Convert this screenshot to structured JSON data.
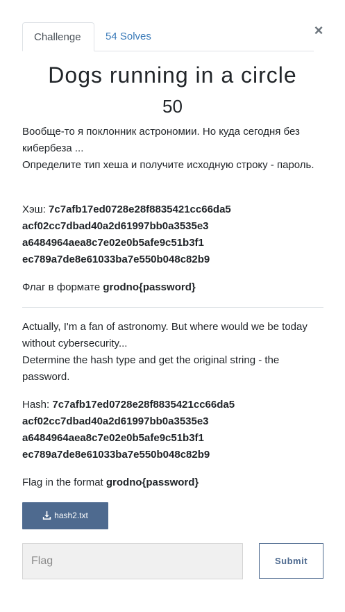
{
  "tabs": {
    "challenge": "Challenge",
    "solves": "54 Solves"
  },
  "close_label": "×",
  "challenge": {
    "name": "Dogs running in a circle",
    "points": "50"
  },
  "description_ru": {
    "line1": "Вообще-то я поклонник астрономии. Но куда сегодня без кибербеза ...",
    "line2": "Определите тип хеша и получите исходную строку - пароль.",
    "hash_label": "Хэш:",
    "hash_lines": [
      "7c7afb17ed0728e28f8835421cc66da5",
      "acf02cc7dbad40a2d61997bb0a3535e3",
      "a6484964aea8c7e02e0b5afe9c51b3f1",
      "ec789a7de8e61033ba7e550b048c82b9"
    ],
    "flag_text": "Флаг в формате",
    "flag_format": "grodno{password}"
  },
  "description_en": {
    "line1": "Actually, I'm a fan of astronomy. But where would we be today without cybersecurity...",
    "line2": "Determine the hash type and get the original string - the password.",
    "hash_label": "Hash:",
    "hash_lines": [
      "7c7afb17ed0728e28f8835421cc66da5",
      "acf02cc7dbad40a2d61997bb0a3535e3",
      "a6484964aea8c7e02e0b5afe9c51b3f1",
      "ec789a7de8e61033ba7e550b048c82b9"
    ],
    "flag_text": "Flag in the format",
    "flag_format": "grodno{password}"
  },
  "file": {
    "name": "hash2.txt",
    "icon": "download-icon"
  },
  "flag_input": {
    "placeholder": "Flag",
    "value": ""
  },
  "submit_label": "Submit",
  "colors": {
    "accent": "#4e6a8f",
    "link": "#3a7ab8"
  }
}
